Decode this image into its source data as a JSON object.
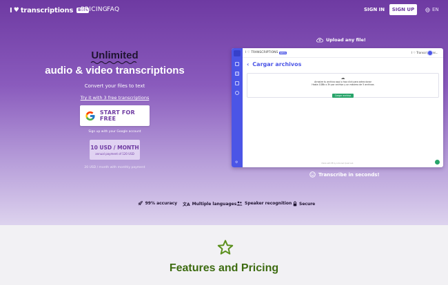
{
  "brand": {
    "prefix": "I",
    "name": "transcriptions",
    "badge": "BETA"
  },
  "nav": {
    "pricing": "PRICING",
    "faq": "FAQ",
    "sign_in": "SIGN IN",
    "sign_up": "SIGN UP",
    "language": "EN"
  },
  "hero": {
    "highlight": "Unlimited",
    "headline": "audio & video transcriptions",
    "subtitle": "Convert your files to text",
    "try_link": "Try it with 3 free transcriptions",
    "start_button": "START FOR FREE",
    "google_note": "Sign up with your Google account",
    "price": "10 USD / MONTH",
    "price_sub": "annual payment of 120 USD",
    "monthly_note": "20 USD / month with monthly payment"
  },
  "preview": {
    "upload_caption": "Upload any file!",
    "transcribe_caption": "Transcribe in seconds!",
    "app_brand": "I ♡ TRANSCRIPTIONS",
    "app_badge": "BETA",
    "app_user": "I ♡ Transcriptions",
    "page_title": "Cargar archivos",
    "drop_line1": "Arrastre tu archivo aquí o haz click para seleccionar",
    "drop_line2": "Hasta 1GBb o 3h por archivo y un máximo de 5 archivos",
    "pick_button": "Cargar archivo",
    "footer": "Made with ♥ by Armored Quiet Lab"
  },
  "features": [
    {
      "icon": "rocket-icon",
      "label": "99% accuracy"
    },
    {
      "icon": "translate-icon",
      "label": "Multiple languages"
    },
    {
      "icon": "speakers-icon",
      "label": "Speaker recognition"
    },
    {
      "icon": "lock-icon",
      "label": "Secure"
    }
  ],
  "section": {
    "title": "Features and Pricing",
    "icon": "star-icon"
  },
  "colors": {
    "brand_purple": "#6e3aa2",
    "accent_green": "#3d6b10",
    "app_blue": "#4b55e6",
    "success_green": "#28a46a"
  }
}
